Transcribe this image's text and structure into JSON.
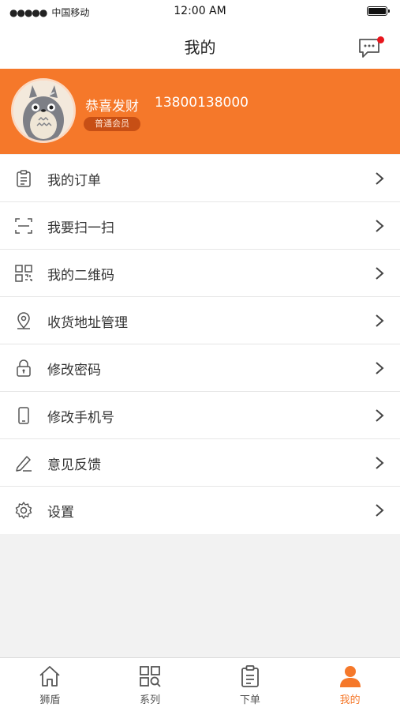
{
  "status_bar": {
    "signal_dots": "●●●●●",
    "carrier": "中国移动",
    "time": "12:00 AM"
  },
  "header": {
    "title": "我的"
  },
  "profile": {
    "name": "恭喜发财",
    "phone": "13800138000",
    "level": "普通会员"
  },
  "menu": [
    {
      "icon": "clipboard-icon",
      "label": "我的订单"
    },
    {
      "icon": "scan-icon",
      "label": "我要扫一扫"
    },
    {
      "icon": "qrcode-icon",
      "label": "我的二维码"
    },
    {
      "icon": "location-pin-icon",
      "label": "收货地址管理"
    },
    {
      "icon": "lock-icon",
      "label": "修改密码"
    },
    {
      "icon": "phone-icon",
      "label": "修改手机号"
    },
    {
      "icon": "pencil-icon",
      "label": "意见反馈"
    },
    {
      "icon": "gear-icon",
      "label": "设置"
    }
  ],
  "tabbar": [
    {
      "icon": "home-icon",
      "label": "狮盾",
      "active": false
    },
    {
      "icon": "grid-search-icon",
      "label": "系列",
      "active": false
    },
    {
      "icon": "clipboard-icon",
      "label": "下单",
      "active": false
    },
    {
      "icon": "person-icon",
      "label": "我的",
      "active": true
    }
  ],
  "colors": {
    "accent": "#f5782a",
    "badge": "#c74f15",
    "notify_dot": "#e8161d",
    "background": "#f2f2f2"
  }
}
